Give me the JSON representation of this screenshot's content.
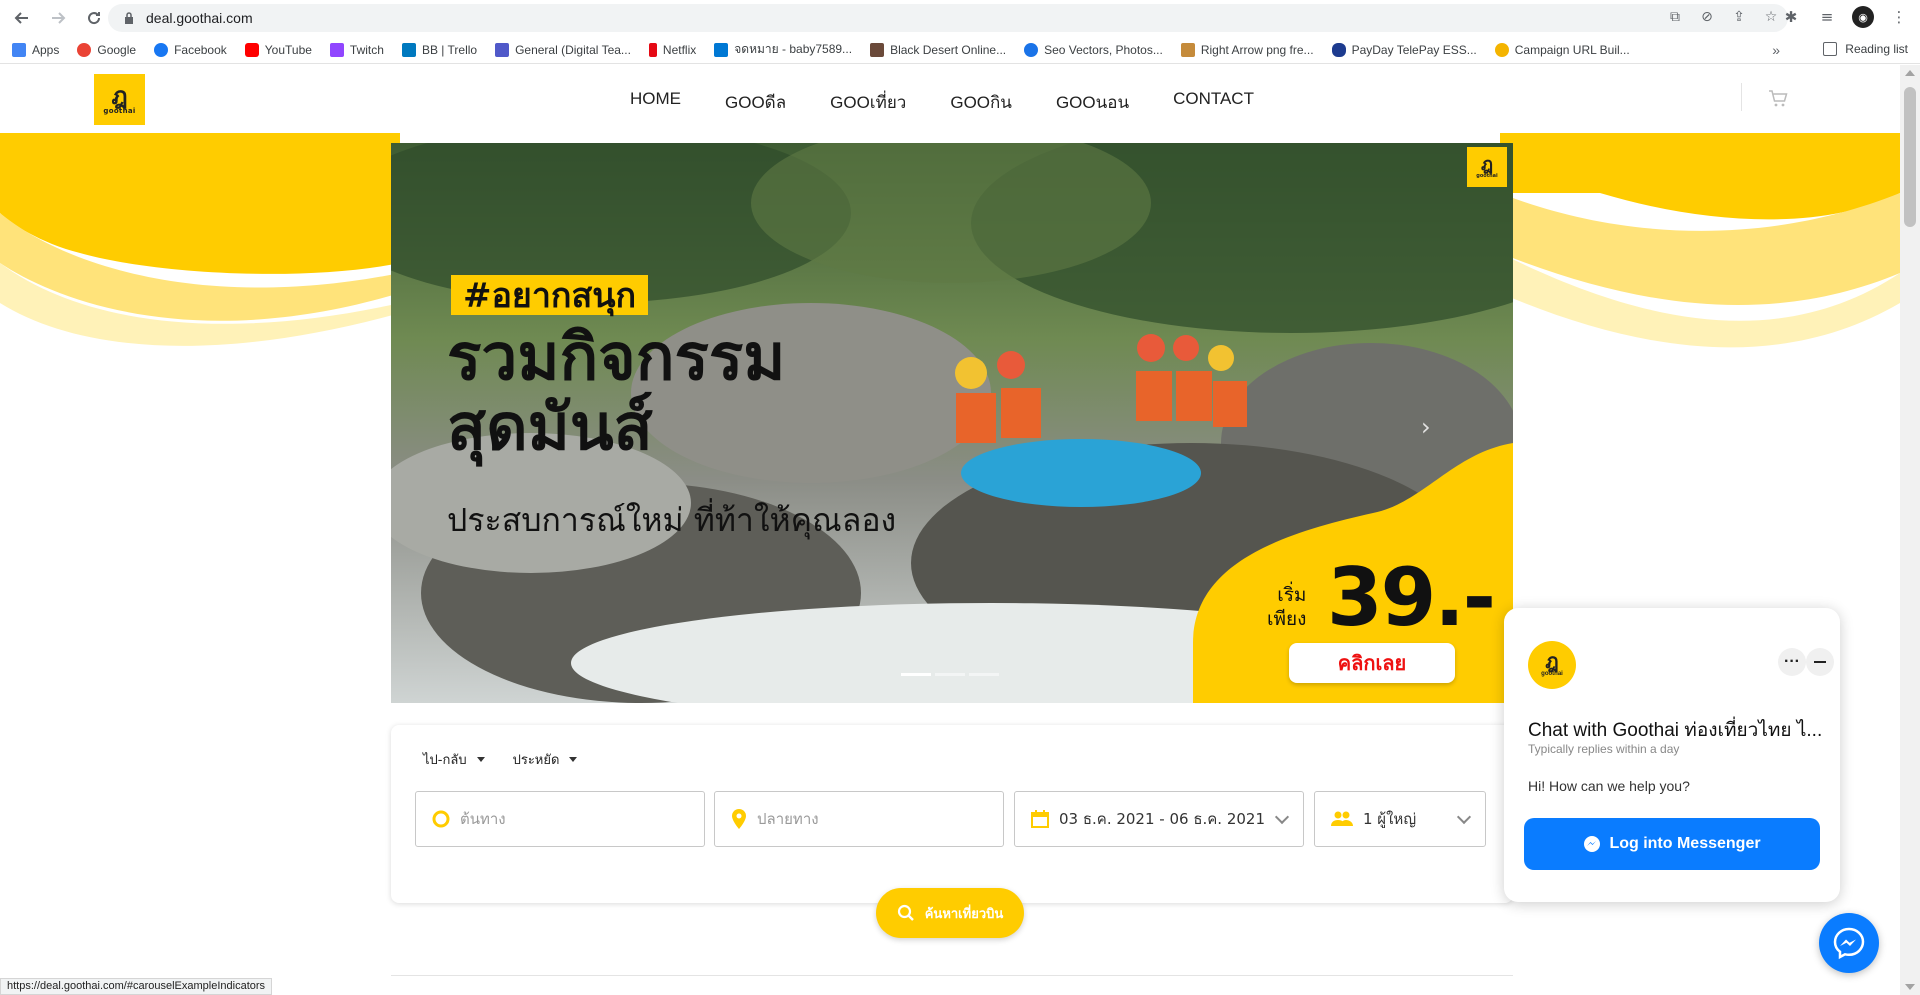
{
  "browser": {
    "url": "deal.goothai.com",
    "status_url": "https://deal.goothai.com/#carouselExampleIndicators",
    "bookmarks": [
      {
        "label": "Apps",
        "color": "#4285f4"
      },
      {
        "label": "Google",
        "color": "#ea4335"
      },
      {
        "label": "Facebook",
        "color": "#1877f2"
      },
      {
        "label": "YouTube",
        "color": "#ff0000"
      },
      {
        "label": "Twitch",
        "color": "#9146ff"
      },
      {
        "label": "BB | Trello",
        "color": "#0079bf"
      },
      {
        "label": "General (Digital Tea...",
        "color": "#5059c9"
      },
      {
        "label": "Netflix",
        "color": "#e50914"
      },
      {
        "label": "จดหมาย - baby7589...",
        "color": "#0078d4"
      },
      {
        "label": "Black Desert Online...",
        "color": "#6b4a3a"
      },
      {
        "label": "Seo Vectors, Photos...",
        "color": "#1a73e8"
      },
      {
        "label": "Right Arrow png fre...",
        "color": "#c58b3b"
      },
      {
        "label": "PayDay TelePay ESS...",
        "color": "#1d3b8f"
      },
      {
        "label": "Campaign URL Buil...",
        "color": "#f4b400"
      }
    ],
    "reading_list": "Reading list"
  },
  "site": {
    "logo_glyph": "ฎ",
    "logo_text": "goothai",
    "menu": [
      "HOME",
      "GOOดีล",
      "GOOเที่ยว",
      "GOOกิน",
      "GOOนอน",
      "CONTACT"
    ],
    "brand_color": "#ffcc00"
  },
  "banner": {
    "hashtag": "#อยากสนุก",
    "headline_1": "รวมกิจกรรม",
    "headline_2": "สุดมันส์",
    "subline": "ประสบการณ์ใหม่ ที่ท้าให้คุณลอง",
    "start_label_1": "เริ่ม",
    "start_label_2": "เพียง",
    "price": "39.-",
    "cta": "คลิกเลย",
    "slide_count": 3,
    "active_slide": 1
  },
  "search": {
    "trip_type": "ไป-กลับ",
    "class": "ประหยัด",
    "origin_placeholder": "ต้นทาง",
    "destination_placeholder": "ปลายทาง",
    "dates": "03 ธ.ค. 2021 - 06 ธ.ค. 2021",
    "passengers": "1 ผู้ใหญ่",
    "button": "ค้นหาเที่ยวบิน"
  },
  "chat": {
    "title": "Chat with Goothai ท่องเที่ยวไทย ไ...",
    "reply_time": "Typically replies within a day",
    "greeting": "Hi! How can we help you?",
    "login": "Log into Messenger",
    "accent": "#0a7cff"
  }
}
